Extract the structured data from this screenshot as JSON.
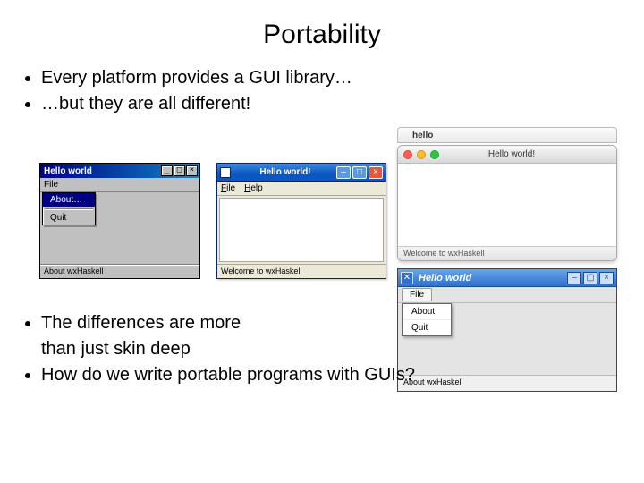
{
  "title": "Portability",
  "bullets_top": [
    "Every platform provides a GUI library…",
    "…but they are all different!"
  ],
  "bullets_bottom": [
    "The differences are more",
    "than just skin deep",
    "How do we write portable programs with GUIs?"
  ],
  "win9x": {
    "title": "Hello world",
    "menu_file": "File",
    "menu_about": "About…",
    "menu_quit": "Quit",
    "status": "About wxHaskell"
  },
  "winxp": {
    "title": "Hello world!",
    "menu_file": "File",
    "menu_help": "Help",
    "status": "Welcome to wxHaskell"
  },
  "mac": {
    "menubar_app": "hello",
    "title": "Hello world!",
    "status": "Welcome to wxHaskell"
  },
  "kde": {
    "title": "Hello world",
    "menu_file": "File",
    "menu_about": "About",
    "menu_quit": "Quit",
    "status": "About wxHaskell"
  }
}
